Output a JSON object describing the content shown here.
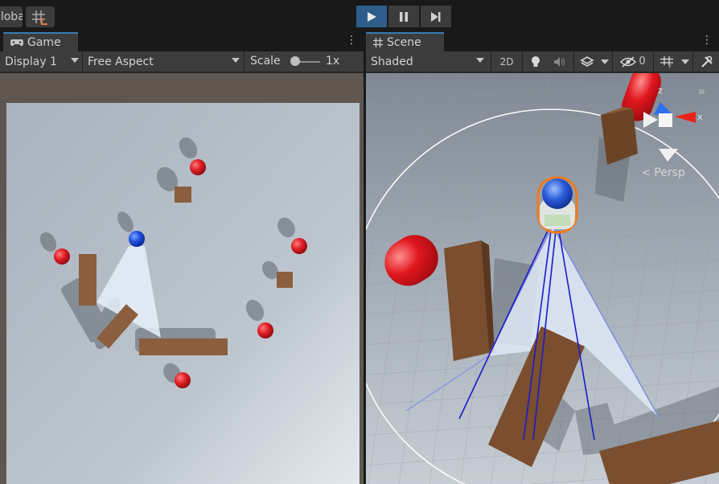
{
  "toolbar": {
    "global_label": "Global",
    "grid_snap_icon": "grid-snap-icon",
    "play_icon": "play-icon",
    "pause_icon": "pause-icon",
    "step_icon": "step-icon",
    "play_active_color": "#2e5d8c"
  },
  "game": {
    "tab_label": "Game",
    "tab_icon": "gamepad-icon",
    "display": "Display 1",
    "aspect": "Free Aspect",
    "scale_label": "Scale",
    "scale_value": "1x"
  },
  "scene": {
    "tab_label": "Scene",
    "tab_icon": "scene-grid-icon",
    "shading_mode": "Shaded",
    "mode_2d": "2D",
    "hidden_count": "0",
    "gizmo_persp_label": "Persp",
    "gizmo_axis_x": "x",
    "gizmo_axis_z": "z"
  }
}
